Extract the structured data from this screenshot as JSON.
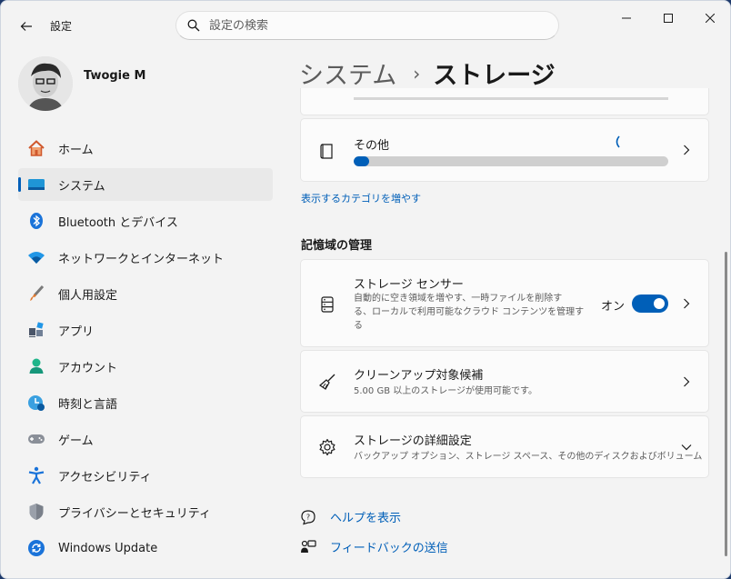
{
  "app": {
    "title": "設定"
  },
  "search": {
    "placeholder": "設定の検索"
  },
  "profile": {
    "name": "Twogie M"
  },
  "sidebar": {
    "items": [
      {
        "label": "ホーム",
        "icon": "home-icon"
      },
      {
        "label": "システム",
        "icon": "system-icon",
        "active": true
      },
      {
        "label": "Bluetooth とデバイス",
        "icon": "bluetooth-icon"
      },
      {
        "label": "ネットワークとインターネット",
        "icon": "wifi-icon"
      },
      {
        "label": "個人用設定",
        "icon": "brush-icon"
      },
      {
        "label": "アプリ",
        "icon": "apps-icon"
      },
      {
        "label": "アカウント",
        "icon": "account-icon"
      },
      {
        "label": "時刻と言語",
        "icon": "time-language-icon"
      },
      {
        "label": "ゲーム",
        "icon": "gamepad-icon"
      },
      {
        "label": "アクセシビリティ",
        "icon": "accessibility-icon"
      },
      {
        "label": "プライバシーとセキュリティ",
        "icon": "shield-icon"
      },
      {
        "label": "Windows Update",
        "icon": "update-icon"
      }
    ]
  },
  "breadcrumb": {
    "parent": "システム",
    "separator": "›",
    "current": "ストレージ"
  },
  "storage": {
    "other": {
      "title": "その他",
      "progress": 0.05
    },
    "show_more_link": "表示するカテゴリを増やす"
  },
  "management": {
    "heading": "記憶域の管理",
    "storage_sense": {
      "title": "ストレージ センサー",
      "desc_line1": "自動的に空き領域を増やす、一時ファイルを削除す",
      "desc_line2": "る、ローカルで利用可能なクラウド コンテンツを管理す",
      "desc_line3": "る",
      "toggle_label": "オン",
      "toggle_on": true
    },
    "cleanup": {
      "title": "クリーンアップ対象候補",
      "desc": "5.00 GB 以上のストレージが使用可能です。"
    },
    "advanced": {
      "title": "ストレージの詳細設定",
      "desc": "バックアップ オプション、ストレージ スペース、その他のディスクおよびボリューム"
    }
  },
  "footer": {
    "help": "ヘルプを表示",
    "feedback": "フィードバックの送信"
  },
  "colors": {
    "accent": "#005fb8",
    "background": "#f3f3f3",
    "card": "#fbfbfb"
  }
}
